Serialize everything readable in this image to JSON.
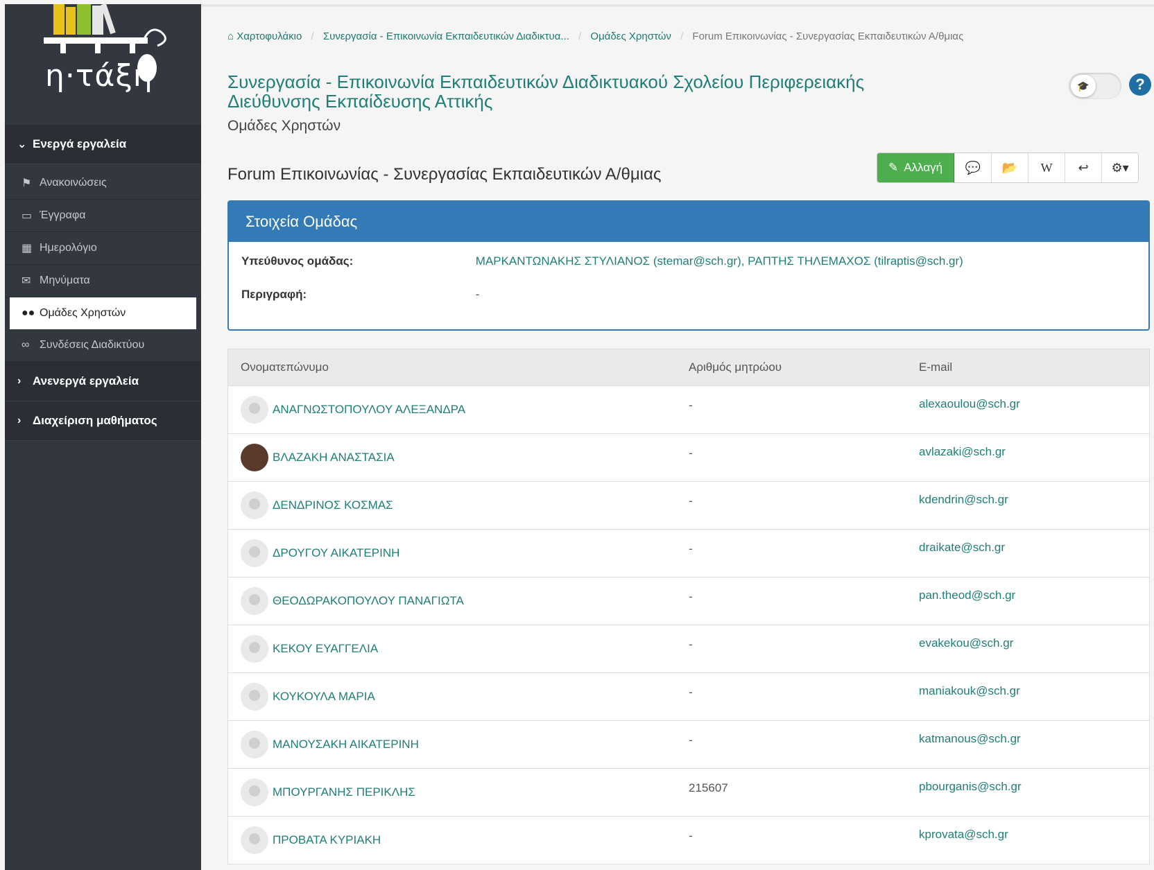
{
  "sidebar": {
    "logo_text": "η·τάξη",
    "active_tools": "Ενεργά εργαλεία",
    "items": [
      {
        "icon": "megaphone-icon",
        "glyph": "📣",
        "label": "Ανακοινώσεις"
      },
      {
        "icon": "folder-open-icon",
        "glyph": "🗁",
        "label": "Έγγραφα"
      },
      {
        "icon": "calendar-icon",
        "glyph": "📅",
        "label": "Ημερολόγιο"
      },
      {
        "icon": "envelope-icon",
        "glyph": "✉",
        "label": "Μηνύματα"
      },
      {
        "icon": "users-icon",
        "glyph": "👥",
        "label": "Ομάδες Χρηστών"
      },
      {
        "icon": "link-icon",
        "glyph": "🔗",
        "label": "Συνδέσεις Διαδικτύου"
      }
    ],
    "inactive_tools": "Ανενεργά εργαλεία",
    "course_admin": "Διαχείριση μαθήματος"
  },
  "breadcrumb": {
    "home": "Χαρτοφυλάκιο",
    "course": "Συνεργασία - Επικοινωνία Εκπαιδευτικών Διαδικτυα...",
    "groups": "Ομάδες Χρηστών",
    "current": "Forum Επικοινωνίας - Συνεργασίας Εκπαιδευτικών Α/θμιας"
  },
  "page": {
    "title": "Συνεργασία - Επικοινωνία Εκπαιδευτικών Διαδικτυακού Σχολείου Περιφερειακής Διεύθυνσης Εκπαίδευσης Αττικής",
    "subtitle": "Ομάδες Χρηστών",
    "help": "?",
    "group_title": "Forum Επικοινωνίας - Συνεργασίας Εκπαιδευτικών Α/θμιας"
  },
  "toolbar": {
    "edit": "Αλλαγή",
    "wiki": "W"
  },
  "panel": {
    "heading": "Στοιχεία Ομάδας",
    "leader_label": "Υπεύθυνος ομάδας:",
    "leader_value": "ΜΑΡΚΑΝΤΩΝΑΚΗΣ ΣΤΥΛΙΑΝΟΣ (stemar@sch.gr), ΡΑΠΤΗΣ ΤΗΛΕΜΑΧΟΣ (tilraptis@sch.gr)",
    "desc_label": "Περιγραφή:",
    "desc_value": "-"
  },
  "table": {
    "headers": [
      "Ονοματεπώνυμο",
      "Αριθμός μητρώου",
      "E-mail"
    ],
    "rows": [
      {
        "name": "ΑΝΑΓΝΩΣΤΟΠΟΥΛΟΥ ΑΛΕΞΑΝΔΡΑ",
        "am": "-",
        "email": "alexaoulou@sch.gr",
        "photo": false
      },
      {
        "name": "ΒΛΑΖΑΚΗ ΑΝΑΣΤΑΣΙΑ",
        "am": "-",
        "email": "avlazaki@sch.gr",
        "photo": true
      },
      {
        "name": "ΔΕΝΔΡΙΝΟΣ ΚΟΣΜΑΣ",
        "am": "-",
        "email": "kdendrin@sch.gr",
        "photo": false
      },
      {
        "name": "ΔΡΟΥΓΟΥ ΑΙΚΑΤΕΡΙΝΗ",
        "am": "-",
        "email": "draikate@sch.gr",
        "photo": false
      },
      {
        "name": "ΘΕΟΔΩΡΑΚΟΠΟΥΛΟΥ ΠΑΝΑΓΙΩΤΑ",
        "am": "-",
        "email": "pan.theod@sch.gr",
        "photo": false
      },
      {
        "name": "ΚΕΚΟΥ ΕΥΑΓΓΕΛΙΑ",
        "am": "-",
        "email": "evakekou@sch.gr",
        "photo": false
      },
      {
        "name": "ΚΟΥΚΟΥΛΑ ΜΑΡΙΑ",
        "am": "-",
        "email": "maniakouk@sch.gr",
        "photo": false
      },
      {
        "name": "ΜΑΝΟΥΣΑΚΗ ΑΙΚΑΤΕΡΙΝΗ",
        "am": "-",
        "email": "katmanous@sch.gr",
        "photo": false
      },
      {
        "name": "ΜΠΟΥΡΓΑΝΗΣ ΠΕΡΙΚΛΗΣ",
        "am": "215607",
        "email": "pbourganis@sch.gr",
        "photo": false
      },
      {
        "name": "ΠΡΟΒΑΤΑ ΚΥΡΙΑΚΗ",
        "am": "-",
        "email": "kprovata@sch.gr",
        "photo": false
      }
    ]
  },
  "colors": {
    "accent": "#1f7f77",
    "panel": "#337ab7",
    "sidebar": "#33373f",
    "edit_button": "#4cae4c"
  }
}
